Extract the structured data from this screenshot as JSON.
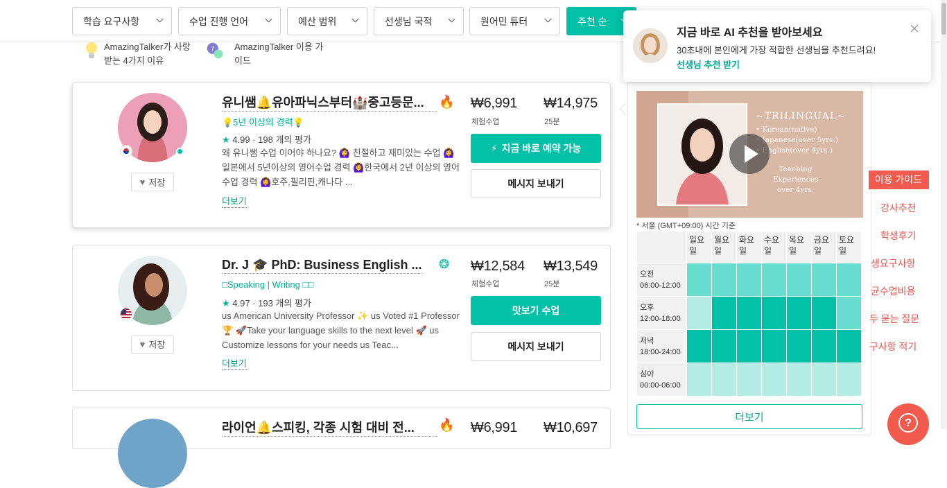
{
  "filters": {
    "needs": "학습 요구사항",
    "language": "수업 진행 언어",
    "budget": "예산 범위",
    "nationality": "선생님 국적",
    "native": "원어민 튜터",
    "sort": "추천 순"
  },
  "reasons": [
    {
      "text": "AmazingTalker가 사랑받는 4가지 이유",
      "icon": "lightbulb-icon"
    },
    {
      "text": "AmazingTalker 이용 가이드",
      "icon": "question-chat-icon"
    }
  ],
  "tutors": [
    {
      "name": "유니쌤🔔유아파닉스부터🏰중고등문...",
      "tag": "💡5년 이상의 경력💡",
      "rating": "4.99",
      "reviews": "198 개의 평가",
      "desc": "왜 유니쌤 수업 이어야 하나요? 🙆‍♀️ 친절하고 재미있는 수업 🙆‍♀️일본에서 5년이상의 영어수업 경력 🙆‍♀️한국에서 2년 이상의 영어수업 경력 🙆‍♀️호주,필리핀,캐나다 ...",
      "more": "더보기",
      "save": "저장",
      "trial_price": "₩6,991",
      "trial_label": "체험수업",
      "price": "₩14,975",
      "price_label": "25분",
      "primary_btn": "지금 바로 예약 가능",
      "message_btn": "메시지 보내기",
      "flag": "kr"
    },
    {
      "name": "Dr. J 🎓 PhD: Business English ...",
      "tag": "□Speaking | Writing □□",
      "rating": "4.97",
      "reviews": "193 개의 평가",
      "desc": "us American University Professor ✨ us Voted #1 Professor🏆 🚀Take your language skills to the next level 🚀 us Customize lessons for your needs us Teac...",
      "more": "더보기",
      "save": "저장",
      "trial_price": "₩12,584",
      "trial_label": "체험수업",
      "price": "₩13,549",
      "price_label": "25분",
      "primary_btn": "맛보기 수업",
      "message_btn": "메시지 보내기",
      "flag": "us"
    },
    {
      "name": "라이언🔔스피킹, 각종 시험 대비 전...",
      "trial_price": "₩6,991",
      "price": "₩10,697"
    }
  ],
  "preview": {
    "video_title": "~TRILINGUAL~",
    "video_lines": [
      "• Korean(native)",
      "• Japanese(over 5yrs.)",
      "• English(over 4yrs.)",
      "",
      "Teaching Experiences",
      "over 4yrs."
    ],
    "timezone": "* 서울 (GMT+09:00) 시간 기준",
    "days": [
      "일요일",
      "월요일",
      "화요일",
      "수요일",
      "목요일",
      "금요일",
      "토요일"
    ],
    "periods": [
      {
        "name": "오전",
        "time": "06:00-12:00",
        "levels": [
          2,
          2,
          2,
          2,
          2,
          2,
          2
        ]
      },
      {
        "name": "오후",
        "time": "12:00-18:00",
        "levels": [
          1,
          3,
          3,
          3,
          3,
          3,
          2
        ]
      },
      {
        "name": "저녁",
        "time": "18:00-24:00",
        "levels": [
          3,
          3,
          3,
          3,
          3,
          3,
          3
        ]
      },
      {
        "name": "심야",
        "time": "00:00-06:00",
        "levels": [
          1,
          1,
          1,
          1,
          1,
          1,
          1
        ]
      }
    ],
    "more": "더보기"
  },
  "popup": {
    "title": "지금 바로 AI 추천을 받아보세요",
    "text": "30초내에 본인에게 가장 적합한 선생님을 추천드려요!",
    "link": "선생님 추천 받기"
  },
  "side_menu": {
    "guide": "이용 가이드",
    "items": [
      "강사추천",
      "학생후기",
      "생요구사항",
      "균수업비용",
      "두 묻는 질문",
      "구사항 적기"
    ]
  },
  "help_icon": "?",
  "colors": {
    "accent": "#00c0a8",
    "side": "#f05a4f"
  }
}
